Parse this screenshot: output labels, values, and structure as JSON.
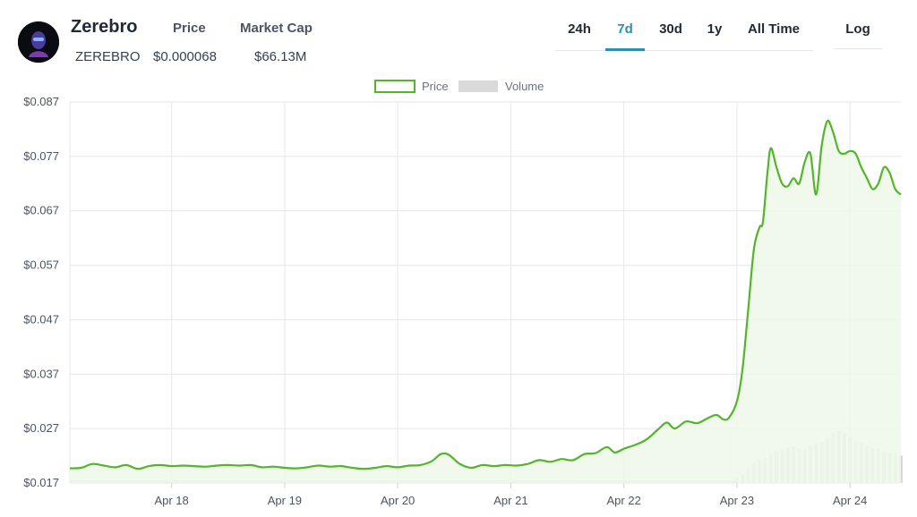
{
  "coin": {
    "name": "Zerebro",
    "symbol": "ZEREBRO",
    "price_label": "Price",
    "price_value": "$0.000068",
    "mcap_label": "Market Cap",
    "mcap_value": "$66.13M"
  },
  "range_tabs": [
    {
      "label": "24h",
      "active": false
    },
    {
      "label": "7d",
      "active": true
    },
    {
      "label": "30d",
      "active": false
    },
    {
      "label": "1y",
      "active": false
    },
    {
      "label": "All Time",
      "active": false
    }
  ],
  "log_label": "Log",
  "colors": {
    "price_line": "#52b52a",
    "price_fill": "#eef8e9",
    "volume_bar": "#d9d9d9",
    "active_tab": "#2b8fb0"
  },
  "chart_data": {
    "type": "line",
    "legend": [
      {
        "label": "Price",
        "kind": "line"
      },
      {
        "label": "Volume",
        "kind": "bar"
      }
    ],
    "legend_position": "top-center",
    "grid": true,
    "y_ticks": [
      "$0.087",
      "$0.077",
      "$0.067",
      "$0.057",
      "$0.047",
      "$0.037",
      "$0.027",
      "$0.017"
    ],
    "ylim": [
      0.017,
      0.087
    ],
    "x_ticks": [
      "Apr 18",
      "Apr 19",
      "Apr 20",
      "Apr 21",
      "Apr 22",
      "Apr 23",
      "Apr 24"
    ],
    "x_range": [
      17.1,
      24.45
    ],
    "price_series": [
      [
        17.1,
        0.0197
      ],
      [
        17.2,
        0.0198
      ],
      [
        17.3,
        0.0205
      ],
      [
        17.4,
        0.0202
      ],
      [
        17.5,
        0.0199
      ],
      [
        17.6,
        0.0203
      ],
      [
        17.7,
        0.0196
      ],
      [
        17.8,
        0.0201
      ],
      [
        17.9,
        0.0203
      ],
      [
        18.0,
        0.0201
      ],
      [
        18.1,
        0.0202
      ],
      [
        18.2,
        0.0201
      ],
      [
        18.3,
        0.02
      ],
      [
        18.4,
        0.0202
      ],
      [
        18.5,
        0.0203
      ],
      [
        18.6,
        0.0202
      ],
      [
        18.7,
        0.0203
      ],
      [
        18.8,
        0.0199
      ],
      [
        18.9,
        0.02
      ],
      [
        19.0,
        0.0198
      ],
      [
        19.1,
        0.0197
      ],
      [
        19.2,
        0.0199
      ],
      [
        19.3,
        0.0202
      ],
      [
        19.4,
        0.02
      ],
      [
        19.5,
        0.0201
      ],
      [
        19.6,
        0.0198
      ],
      [
        19.7,
        0.0196
      ],
      [
        19.8,
        0.0198
      ],
      [
        19.9,
        0.0201
      ],
      [
        20.0,
        0.0199
      ],
      [
        20.1,
        0.0202
      ],
      [
        20.2,
        0.0203
      ],
      [
        20.3,
        0.021
      ],
      [
        20.38,
        0.0223
      ],
      [
        20.45,
        0.0222
      ],
      [
        20.55,
        0.0205
      ],
      [
        20.65,
        0.0198
      ],
      [
        20.75,
        0.0203
      ],
      [
        20.85,
        0.0201
      ],
      [
        20.95,
        0.0203
      ],
      [
        21.05,
        0.0202
      ],
      [
        21.15,
        0.0205
      ],
      [
        21.25,
        0.0212
      ],
      [
        21.35,
        0.0209
      ],
      [
        21.45,
        0.0214
      ],
      [
        21.55,
        0.0212
      ],
      [
        21.65,
        0.0223
      ],
      [
        21.75,
        0.0225
      ],
      [
        21.85,
        0.0236
      ],
      [
        21.92,
        0.0226
      ],
      [
        22.0,
        0.0233
      ],
      [
        22.1,
        0.024
      ],
      [
        22.2,
        0.025
      ],
      [
        22.3,
        0.0268
      ],
      [
        22.38,
        0.0281
      ],
      [
        22.45,
        0.027
      ],
      [
        22.55,
        0.0283
      ],
      [
        22.65,
        0.028
      ],
      [
        22.75,
        0.029
      ],
      [
        22.82,
        0.0295
      ],
      [
        22.88,
        0.0287
      ],
      [
        22.93,
        0.029
      ],
      [
        23.0,
        0.032
      ],
      [
        23.05,
        0.038
      ],
      [
        23.1,
        0.049
      ],
      [
        23.15,
        0.06
      ],
      [
        23.2,
        0.064
      ],
      [
        23.23,
        0.065
      ],
      [
        23.27,
        0.074
      ],
      [
        23.3,
        0.0785
      ],
      [
        23.35,
        0.075
      ],
      [
        23.4,
        0.072
      ],
      [
        23.45,
        0.0715
      ],
      [
        23.5,
        0.073
      ],
      [
        23.55,
        0.072
      ],
      [
        23.6,
        0.076
      ],
      [
        23.65,
        0.0775
      ],
      [
        23.7,
        0.07
      ],
      [
        23.75,
        0.079
      ],
      [
        23.8,
        0.0835
      ],
      [
        23.85,
        0.0815
      ],
      [
        23.9,
        0.078
      ],
      [
        23.95,
        0.0775
      ],
      [
        24.0,
        0.078
      ],
      [
        24.05,
        0.0775
      ],
      [
        24.1,
        0.075
      ],
      [
        24.15,
        0.073
      ],
      [
        24.2,
        0.071
      ],
      [
        24.25,
        0.072
      ],
      [
        24.3,
        0.075
      ],
      [
        24.35,
        0.074
      ],
      [
        24.4,
        0.071
      ],
      [
        24.45,
        0.07
      ]
    ],
    "volume_series": [
      [
        23.0,
        0.06
      ],
      [
        23.05,
        0.09
      ],
      [
        23.1,
        0.15
      ],
      [
        23.15,
        0.22
      ],
      [
        23.2,
        0.26
      ],
      [
        23.25,
        0.28
      ],
      [
        23.3,
        0.32
      ],
      [
        23.35,
        0.35
      ],
      [
        23.4,
        0.37
      ],
      [
        23.45,
        0.39
      ],
      [
        23.5,
        0.4
      ],
      [
        23.55,
        0.38
      ],
      [
        23.6,
        0.36
      ],
      [
        23.65,
        0.41
      ],
      [
        23.7,
        0.43
      ],
      [
        23.75,
        0.44
      ],
      [
        23.8,
        0.5
      ],
      [
        23.85,
        0.55
      ],
      [
        23.9,
        0.57
      ],
      [
        23.95,
        0.55
      ],
      [
        24.0,
        0.5
      ],
      [
        24.05,
        0.46
      ],
      [
        24.1,
        0.44
      ],
      [
        24.15,
        0.4
      ],
      [
        24.2,
        0.38
      ],
      [
        24.25,
        0.37
      ],
      [
        24.3,
        0.34
      ],
      [
        24.35,
        0.33
      ],
      [
        24.4,
        0.31
      ],
      [
        24.45,
        0.3
      ]
    ]
  }
}
